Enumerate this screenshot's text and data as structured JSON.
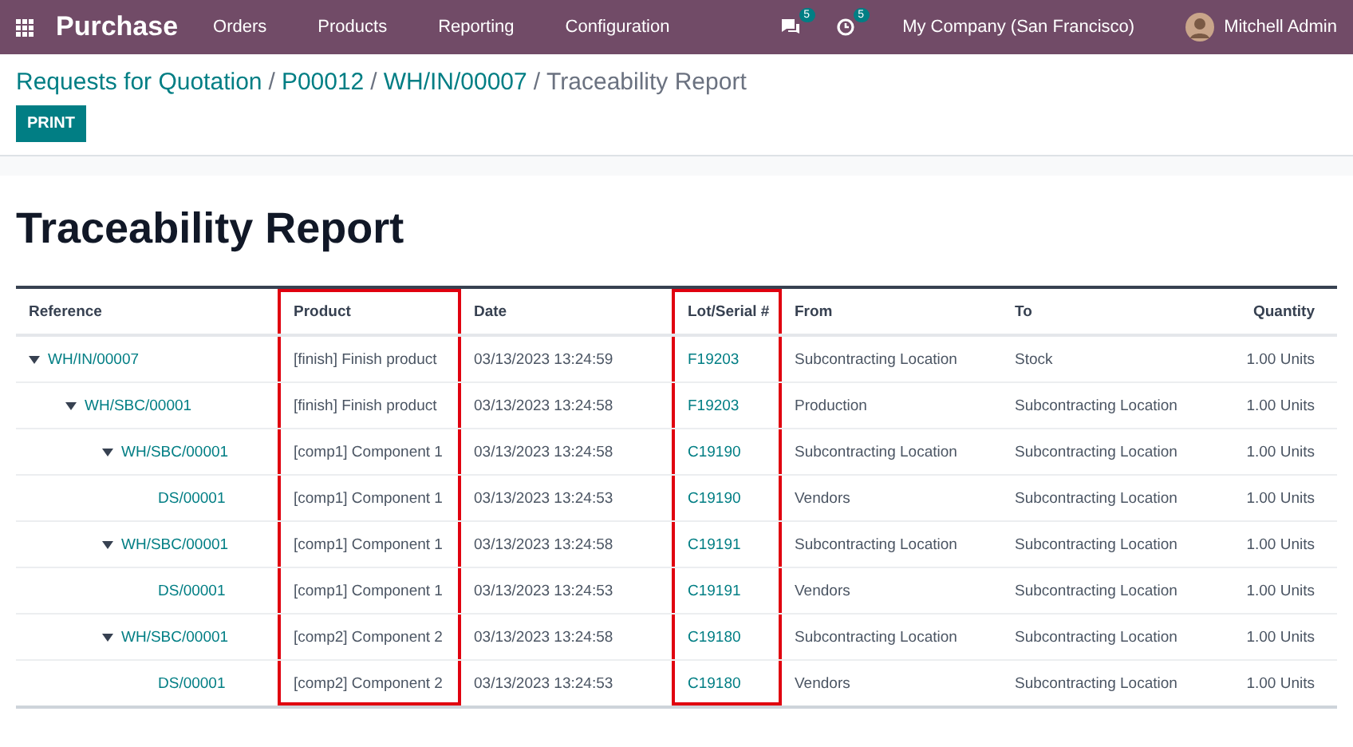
{
  "navbar": {
    "app_name": "Purchase",
    "menu": [
      "Orders",
      "Products",
      "Reporting",
      "Configuration"
    ],
    "messages_badge": "5",
    "activities_badge": "5",
    "company": "My Company (San Francisco)",
    "user": "Mitchell Admin"
  },
  "breadcrumb": {
    "links": [
      "Requests for Quotation",
      "P00012",
      "WH/IN/00007"
    ],
    "separator": "/",
    "current": "Traceability Report"
  },
  "print_button": "PRINT",
  "title": "Traceability Report",
  "columns": [
    {
      "label": "Reference",
      "highlighted": false
    },
    {
      "label": "Product",
      "highlighted": true
    },
    {
      "label": "Date",
      "highlighted": false
    },
    {
      "label": "Lot/Serial #",
      "highlighted": true
    },
    {
      "label": "From",
      "highlighted": false
    },
    {
      "label": "To",
      "highlighted": false
    },
    {
      "label": "Quantity",
      "highlighted": false
    }
  ],
  "rows": [
    {
      "reference": "WH/IN/00007",
      "product": "[finish] Finish product",
      "date": "03/13/2023 13:24:59",
      "lot": "F19203",
      "from": "Subcontracting Location",
      "to": "Stock",
      "quantity": "1.00 Units",
      "expanded": true,
      "children": [
        {
          "reference": "WH/SBC/00001",
          "product": "[finish] Finish product",
          "date": "03/13/2023 13:24:58",
          "lot": "F19203",
          "from": "Production",
          "to": "Subcontracting Location",
          "quantity": "1.00 Units",
          "expanded": true,
          "children": [
            {
              "reference": "WH/SBC/00001",
              "product": "[comp1] Component 1",
              "date": "03/13/2023 13:24:58",
              "lot": "C19190",
              "from": "Subcontracting Location",
              "to": "Subcontracting Location",
              "quantity": "1.00 Units",
              "expanded": true,
              "children": [
                {
                  "reference": "DS/00001",
                  "product": "[comp1] Component 1",
                  "date": "03/13/2023 13:24:53",
                  "lot": "C19190",
                  "from": "Vendors",
                  "to": "Subcontracting Location",
                  "quantity": "1.00 Units"
                }
              ]
            },
            {
              "reference": "WH/SBC/00001",
              "product": "[comp1] Component 1",
              "date": "03/13/2023 13:24:58",
              "lot": "C19191",
              "from": "Subcontracting Location",
              "to": "Subcontracting Location",
              "quantity": "1.00 Units",
              "expanded": true,
              "children": [
                {
                  "reference": "DS/00001",
                  "product": "[comp1] Component 1",
                  "date": "03/13/2023 13:24:53",
                  "lot": "C19191",
                  "from": "Vendors",
                  "to": "Subcontracting Location",
                  "quantity": "1.00 Units"
                }
              ]
            },
            {
              "reference": "WH/SBC/00001",
              "product": "[comp2] Component 2",
              "date": "03/13/2023 13:24:58",
              "lot": "C19180",
              "from": "Subcontracting Location",
              "to": "Subcontracting Location",
              "quantity": "1.00 Units",
              "expanded": true,
              "children": [
                {
                  "reference": "DS/00001",
                  "product": "[comp2] Component 2",
                  "date": "03/13/2023 13:24:53",
                  "lot": "C19180",
                  "from": "Vendors",
                  "to": "Subcontracting Location",
                  "quantity": "1.00 Units"
                }
              ]
            }
          ]
        }
      ]
    }
  ]
}
